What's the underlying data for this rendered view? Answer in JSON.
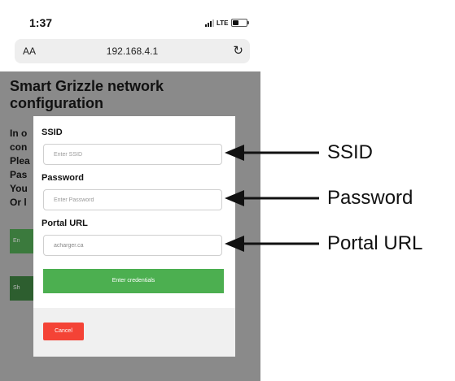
{
  "status_bar": {
    "time": "1:37",
    "network": "LTE"
  },
  "browser": {
    "text_size_label": "AA",
    "url": "192.168.4.1",
    "reload_icon": "reload-icon"
  },
  "page": {
    "title": "Smart Grizzle network configuration",
    "partial_lines": [
      "In o",
      "con",
      "Plea",
      "Pas",
      "You",
      "Or l"
    ],
    "partial_buttons": [
      "En",
      "Sh"
    ]
  },
  "modal": {
    "ssid_label": "SSID",
    "ssid_placeholder": "Enter SSID",
    "password_label": "Password",
    "password_placeholder": "Enter Password",
    "portal_label": "Portal URL",
    "portal_value": "acharger.ca",
    "submit_label": "Enter credentials",
    "cancel_label": "Cancel"
  },
  "annotations": [
    "SSID",
    "Password",
    "Portal URL"
  ],
  "colors": {
    "submit": "#4caf50",
    "cancel": "#f44336",
    "overlay": "#8a8a8a"
  }
}
